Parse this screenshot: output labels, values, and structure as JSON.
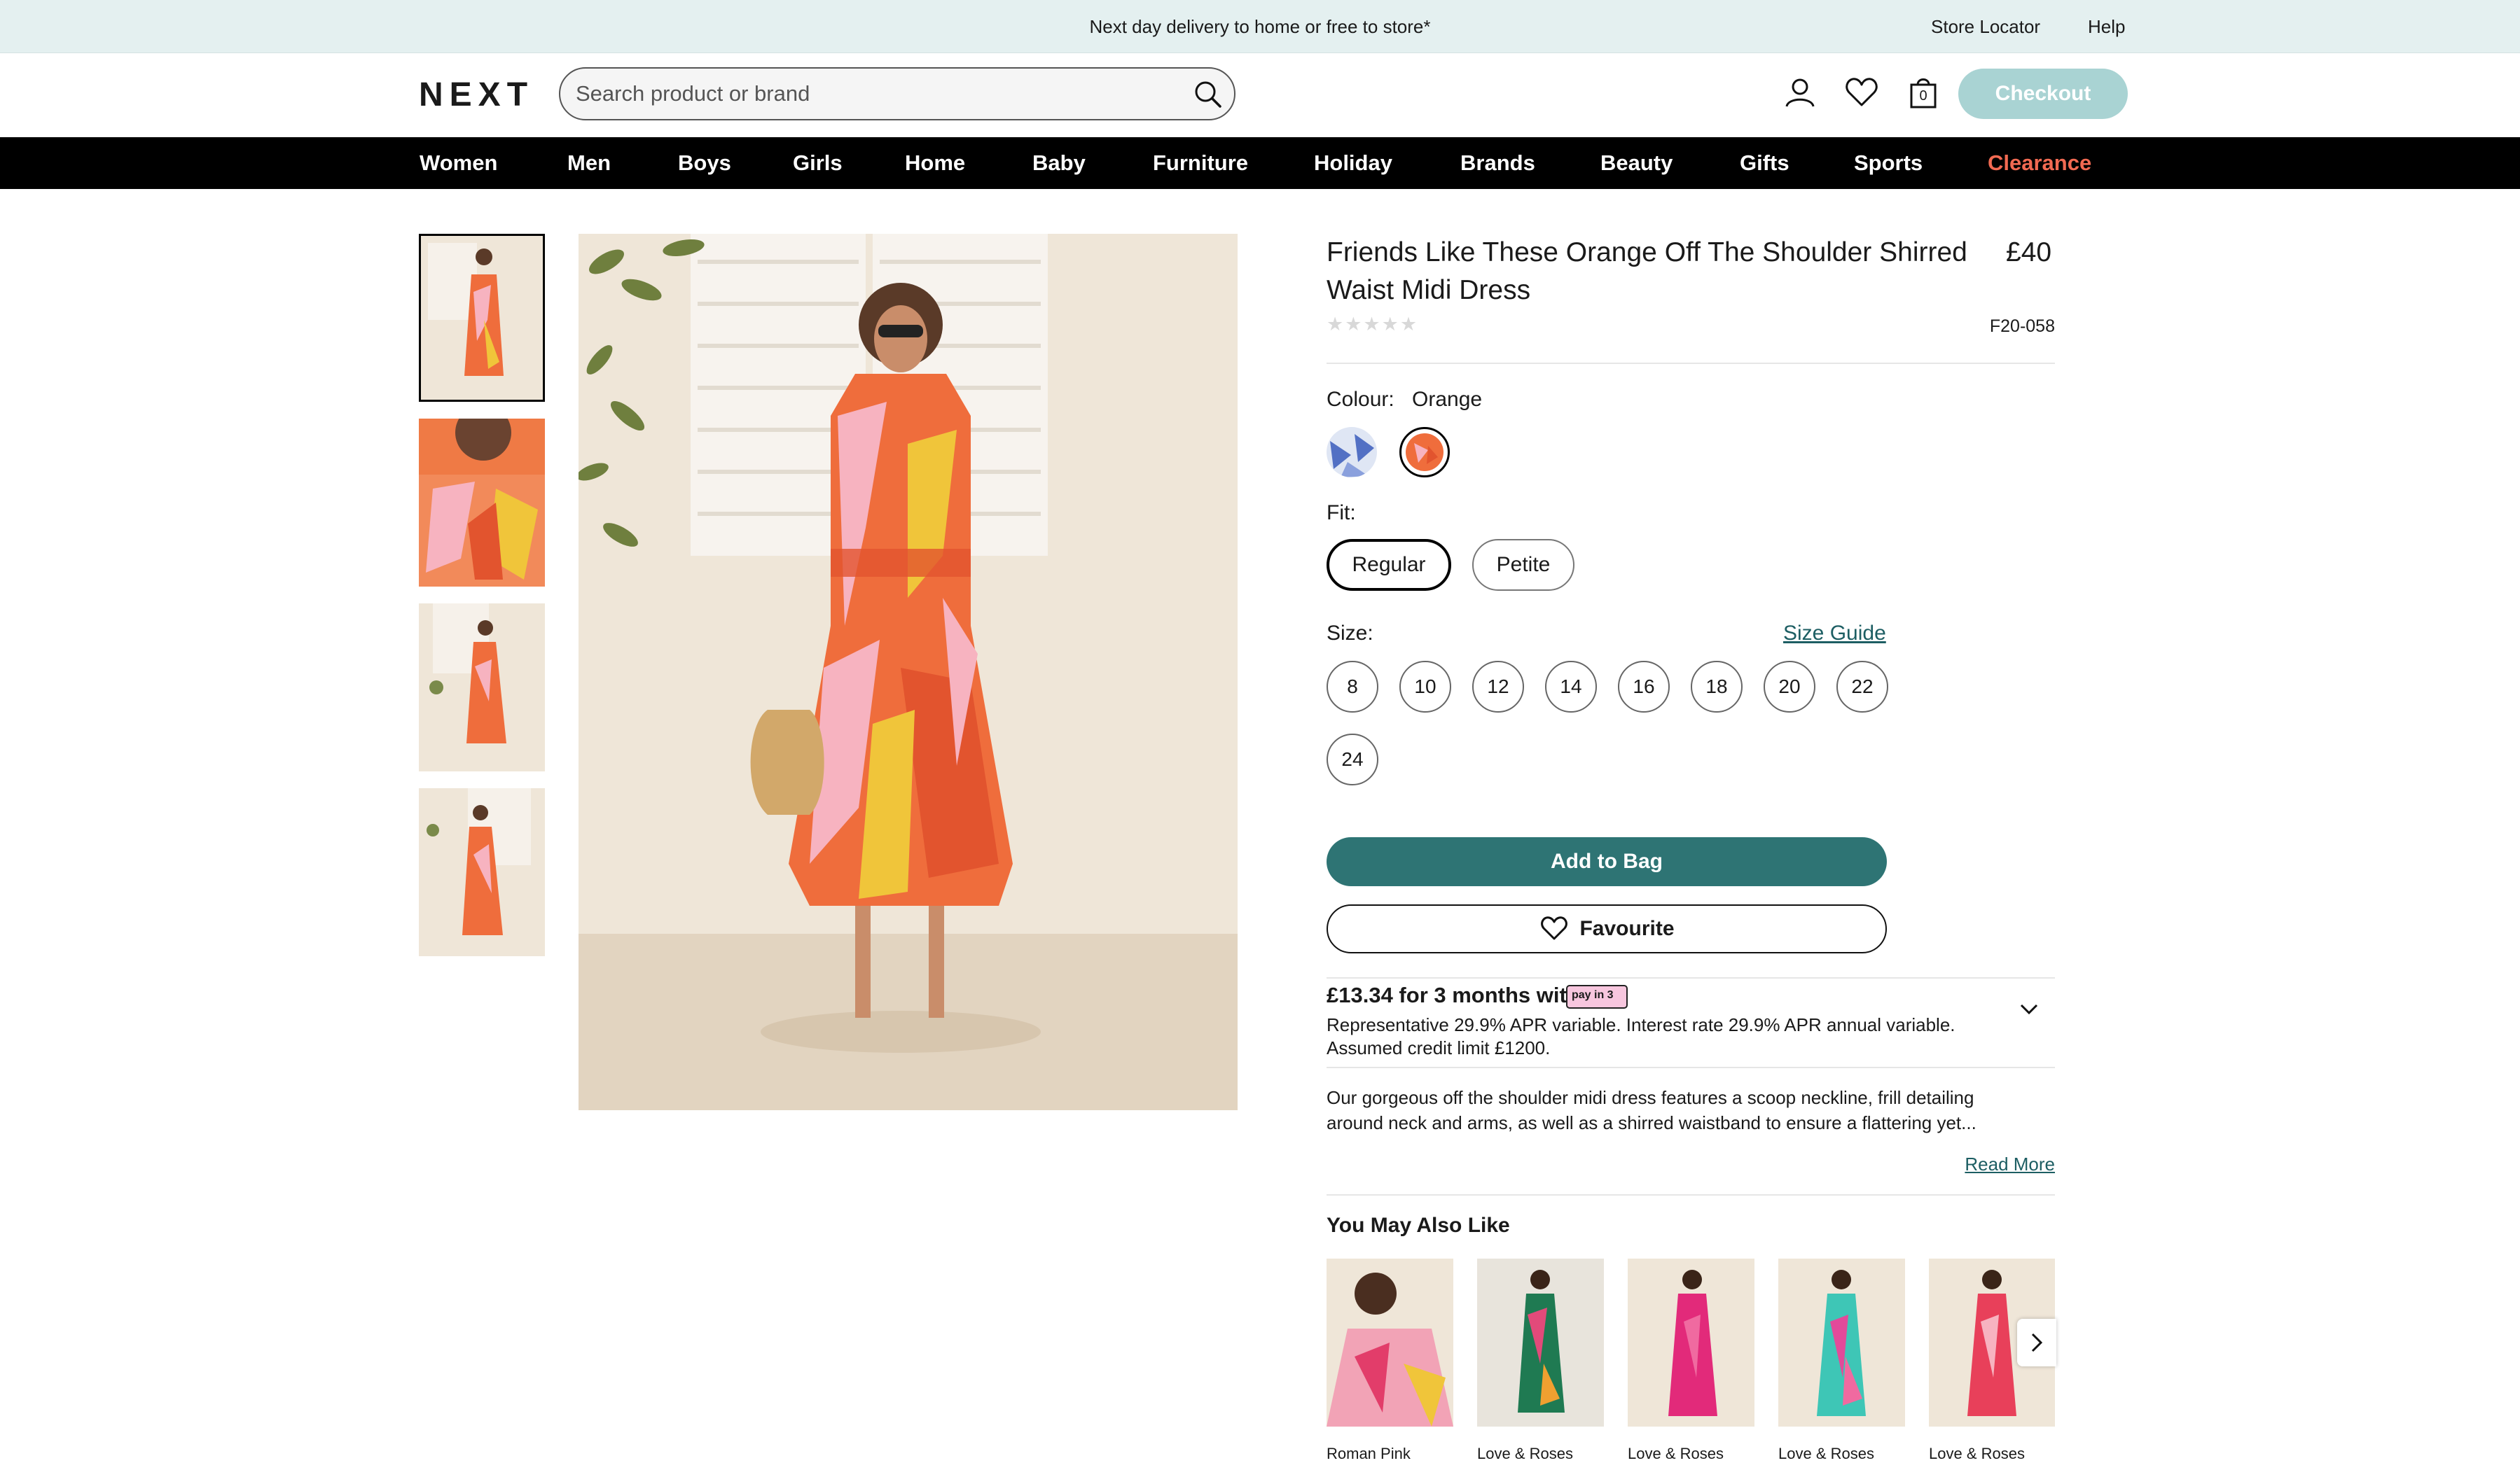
{
  "banner": {
    "message": "Next day delivery to home or free to store*",
    "store_locator": "Store Locator",
    "help": "Help"
  },
  "header": {
    "logo": "NEXT",
    "search_placeholder": "Search product or brand",
    "bag_count": "0",
    "checkout_label": "Checkout"
  },
  "nav": {
    "items": [
      "Women",
      "Men",
      "Boys",
      "Girls",
      "Home",
      "Baby",
      "Furniture",
      "Holiday",
      "Brands",
      "Beauty",
      "Gifts",
      "Sports",
      "Clearance"
    ],
    "highlight_color": "#f26a52"
  },
  "product": {
    "title": "Friends Like These Orange Off The Shoulder Shirred Waist Midi Dress",
    "price": "£40",
    "rating_stars": 0,
    "code": "F20-058",
    "colour_label": "Colour:",
    "colour_value": "Orange",
    "fit_label": "Fit:",
    "fits": [
      "Regular",
      "Petite"
    ],
    "size_label": "Size:",
    "size_guide": "Size Guide",
    "sizes": [
      "8",
      "10",
      "12",
      "14",
      "16",
      "18",
      "20",
      "22",
      "24"
    ],
    "add_to_bag": "Add to Bag",
    "favourite": "Favourite",
    "finance_headline": "£13.34 for 3 months with",
    "finance_badge": "pay in 3",
    "finance_apr": "Representative 29.9% APR variable. Interest rate 29.9% APR annual variable. Assumed credit limit £1200.",
    "description": "Our gorgeous off the shoulder midi dress features a scoop neckline, frill detailing around neck and arms, as well as a shirred waistband to ensure a flattering yet...",
    "read_more": "Read More"
  },
  "recommendations": {
    "heading": "You May Also Like",
    "items": [
      {
        "caption": "Roman Pink"
      },
      {
        "caption": "Love & Roses"
      },
      {
        "caption": "Love & Roses"
      },
      {
        "caption": "Love & Roses"
      },
      {
        "caption": "Love & Roses"
      }
    ]
  },
  "colors": {
    "accent": "#2e7474",
    "checkout": "#a9d3d3",
    "banner_bg": "#e4f0f0"
  }
}
